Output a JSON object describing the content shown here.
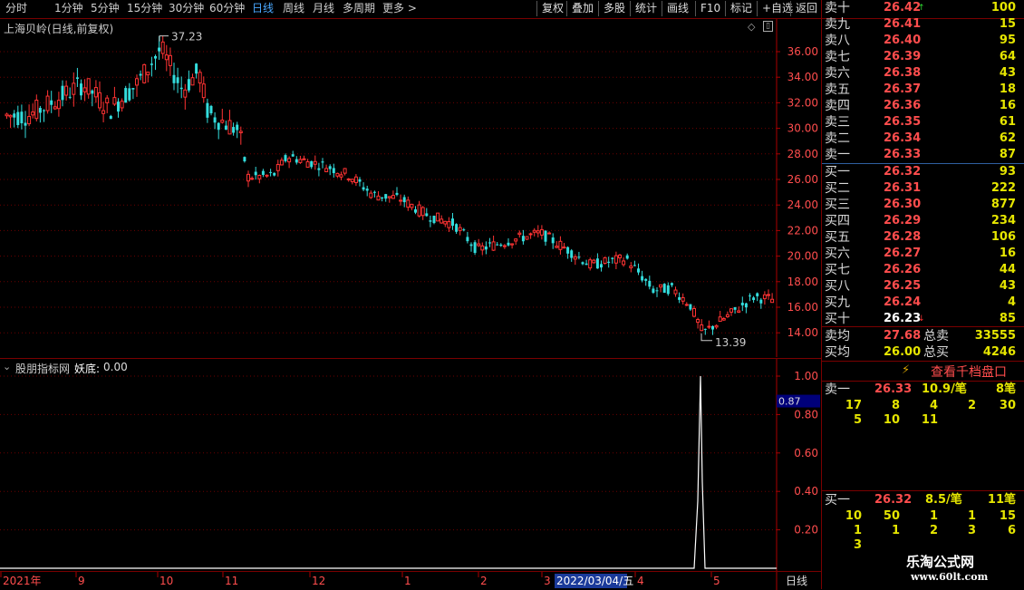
{
  "toolbar": {
    "periods": [
      "分时",
      "1分钟",
      "5分钟",
      "15分钟",
      "30分钟",
      "60分钟",
      "日线",
      "周线",
      "月线",
      "多周期",
      "更多"
    ],
    "active_period": "日线",
    "actions": [
      "复权",
      "叠加",
      "多股",
      "统计",
      "画线",
      "F10",
      "标记",
      "+自选",
      "返回"
    ]
  },
  "main_chart": {
    "title": "上海贝岭(日线,前复权)",
    "high_label": "37.23",
    "low_label": "13.39",
    "y_ticks": [
      "36.00",
      "34.00",
      "32.00",
      "30.00",
      "28.00",
      "26.00",
      "24.00",
      "22.00",
      "20.00",
      "18.00",
      "16.00",
      "14.00"
    ]
  },
  "sub_chart": {
    "title": "股朋指标网",
    "indicator_name": "妖底:",
    "indicator_value": "0.00",
    "current_value": "0.87",
    "y_ticks": [
      "1.00",
      "0.80",
      "0.60",
      "0.40",
      "0.20"
    ]
  },
  "date_axis": {
    "labels": [
      "2021年",
      "9",
      "10",
      "11",
      "12",
      "1",
      "2",
      "3",
      "4",
      "5"
    ],
    "cursor_date": "2022/03/04/五",
    "period_label": "日线"
  },
  "order_book": {
    "asks": [
      {
        "label": "卖十",
        "price": "26.42",
        "volume": "100",
        "arrow": "up"
      },
      {
        "label": "卖九",
        "price": "26.41",
        "volume": "15"
      },
      {
        "label": "卖八",
        "price": "26.40",
        "volume": "95"
      },
      {
        "label": "卖七",
        "price": "26.39",
        "volume": "64"
      },
      {
        "label": "卖六",
        "price": "26.38",
        "volume": "43"
      },
      {
        "label": "卖五",
        "price": "26.37",
        "volume": "18"
      },
      {
        "label": "卖四",
        "price": "26.36",
        "volume": "16"
      },
      {
        "label": "卖三",
        "price": "26.35",
        "volume": "61"
      },
      {
        "label": "卖二",
        "price": "26.34",
        "volume": "62"
      },
      {
        "label": "卖一",
        "price": "26.33",
        "volume": "87"
      }
    ],
    "bids": [
      {
        "label": "买一",
        "price": "26.32",
        "volume": "93"
      },
      {
        "label": "买二",
        "price": "26.31",
        "volume": "222"
      },
      {
        "label": "买三",
        "price": "26.30",
        "volume": "877"
      },
      {
        "label": "买四",
        "price": "26.29",
        "volume": "234"
      },
      {
        "label": "买五",
        "price": "26.28",
        "volume": "106"
      },
      {
        "label": "买六",
        "price": "26.27",
        "volume": "16"
      },
      {
        "label": "买七",
        "price": "26.26",
        "volume": "44"
      },
      {
        "label": "买八",
        "price": "26.25",
        "volume": "43"
      },
      {
        "label": "买九",
        "price": "26.24",
        "volume": "4"
      },
      {
        "label": "买十",
        "price": "26.23",
        "volume": "85",
        "arrow": "down"
      }
    ],
    "ask_avg": {
      "label": "卖均",
      "price": "27.68",
      "total_label": "总卖",
      "total": "33555"
    },
    "bid_avg": {
      "label": "买均",
      "price": "26.00",
      "total_label": "总买",
      "total": "4246"
    },
    "view_button": "查看千档盘口",
    "ask1_queue": {
      "label": "卖一",
      "price": "26.33",
      "per": "10.9/笔",
      "count": "8笔",
      "orders": [
        "17",
        "8",
        "4",
        "2",
        "30",
        "5",
        "10",
        "11"
      ]
    },
    "bid1_queue": {
      "label": "买一",
      "price": "26.32",
      "per": "8.5/笔",
      "count": "11笔",
      "orders": [
        "10",
        "50",
        "1",
        "1",
        "15",
        "1",
        "1",
        "2",
        "3",
        "6",
        "3"
      ]
    }
  },
  "watermark": {
    "name": "乐淘公式网",
    "url": "www.60lt.com"
  },
  "colors": {
    "up": "#ff3333",
    "down": "#33dddd",
    "grid": "#6b0000",
    "accent": "#4aa8ff",
    "volume": "#e6e600"
  }
}
